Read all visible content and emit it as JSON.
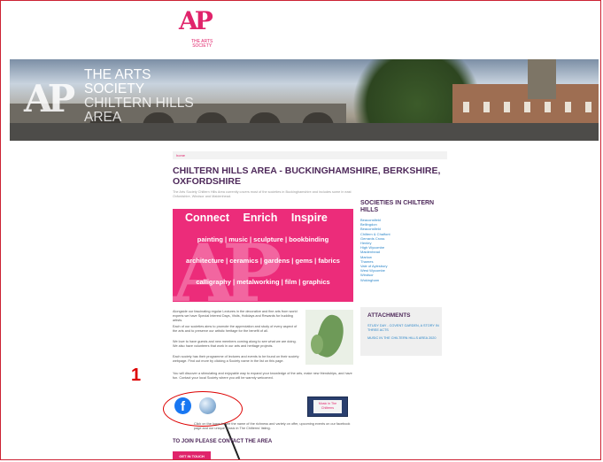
{
  "logo": {
    "mark": "AP",
    "lines": [
      "THE ARTS",
      "SOCIETY"
    ]
  },
  "hero": {
    "title_lines": [
      "THE ARTS",
      "SOCIETY",
      "CHILTERN HILLS",
      "AREA"
    ]
  },
  "breadcrumb": "home",
  "page_title": "CHILTERN HILLS AREA - BUCKINGHAMSHIRE, BERKSHIRE, OXFORDSHIRE",
  "intro": "The Arts Society Chiltern Hills Area currently covers most of the societies in Buckinghamshire and includes some in east Oxfordshire, Windsor and Maidenhead.",
  "banner": {
    "words": [
      "Connect",
      "Enrich",
      "Inspire"
    ],
    "line1": "painting | music | sculpture | bookbinding",
    "line2": "architecture | ceramics | gardens | gems | fabrics",
    "line3": "calligraphy | metalworking | film | graphics"
  },
  "paragraphs": [
    "Alongside our fascinating regular Lectures in the decorative and fine arts from world experts we have Special Interest Days, Visits, Holidays and Rewards for budding artists.",
    "Each of our societies aims to promote the appreciation and study of every aspect of the arts and to preserve our artistic heritage for the benefit of all.",
    "We love to have guests and new members coming along to see what we are doing. We also have volunteers that work in our arts and heritage projects.",
    "Each society has their programme of lectures and events to be found on their society webpage. Find out more by clicking a Society name in the list on this page."
  ],
  "wide_text": "You will discover a stimulating and enjoyable way to expand your knowledge of the arts, make new friendships, and have fun. Contact your local Society where you will be warmly welcomed.",
  "annotation_number": "1",
  "icons": {
    "facebook_glyph": "f"
  },
  "poster_text": "Music in The Chilterns",
  "small_text": "Click on the logos to see the name of the richness and variety on offer, upcoming events on our facebook page and our unique 'Music in The Chilterns' listing.",
  "join_heading": "TO JOIN PLEASE CONTACT THE AREA",
  "join_button": "GET IN TOUCH",
  "sidebar": {
    "title": "SOCIETIES IN CHILTERN HILLS",
    "items": [
      "Beaconsfield",
      "Bellingdon",
      "Beaconsfield",
      "Chiltern & Chalfont",
      "Gerrards Cross",
      "Henley",
      "High Wycombe",
      "Maidenhead",
      "Marlow",
      "Thames",
      "Vale of Aylesbury",
      "West Wycombe",
      "Windsor",
      "Wokingham"
    ]
  },
  "attachments": {
    "title": "ATTACHMENTS",
    "items": [
      "STUDY DAY - COVENT GARDEN, A STORY IN THREE ACTS",
      "MUSIC IN THE CHILTERN HILLS AREA 2020"
    ]
  },
  "colors": {
    "brand_pink": "#e0246b",
    "heading_purple": "#4f2a5b",
    "link_blue": "#2a85c8",
    "annotation_red": "#dd0000"
  }
}
